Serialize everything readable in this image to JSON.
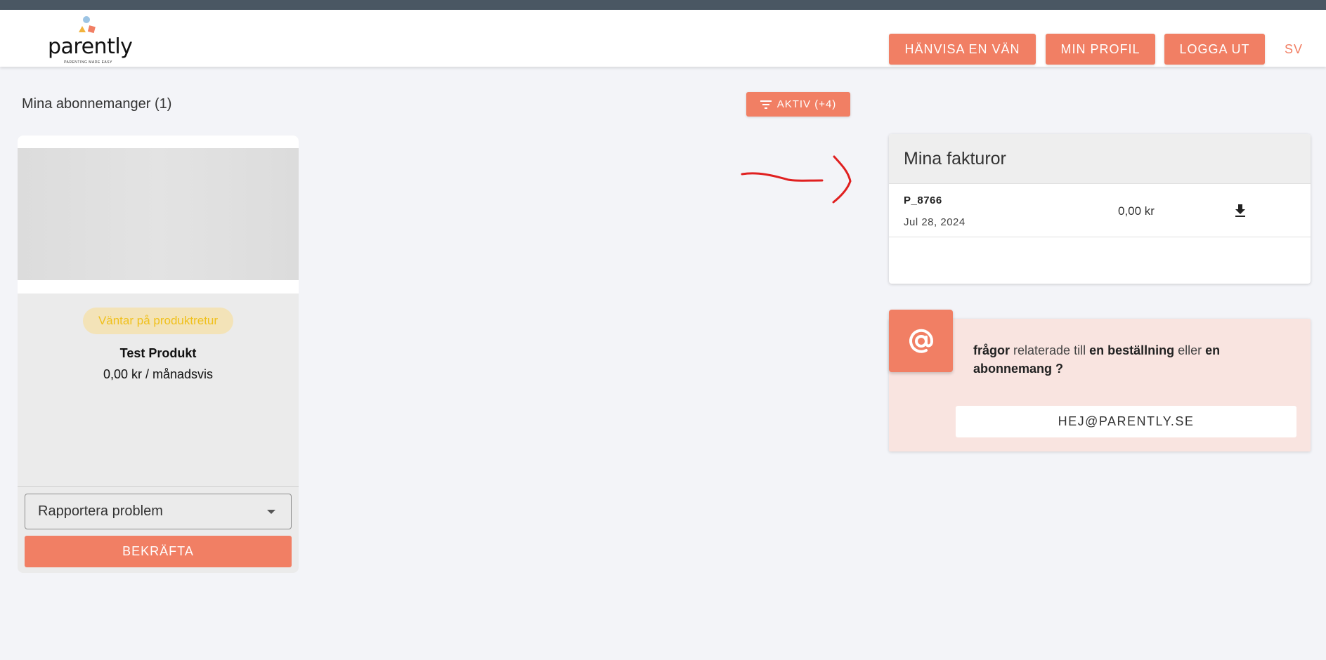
{
  "header": {
    "logo": {
      "wordmark": "parently",
      "tagline": "PARENTING MADE EASY"
    },
    "nav": [
      {
        "label": "HÄNVISA EN VÄN"
      },
      {
        "label": "MIN PROFIL"
      },
      {
        "label": "LOGGA UT"
      }
    ],
    "language": "SV"
  },
  "subscriptions": {
    "title": "Mina abonnemanger (1)",
    "filter_label": "AKTIV (+4)",
    "filter_icon": "filter-list-icon",
    "card": {
      "status": "Väntar på produktretur",
      "product_name": "Test Produkt",
      "price": "0,00 kr / månadsvis",
      "select_value": "Rapportera problem",
      "confirm_label": "BEKRÄFTA"
    }
  },
  "invoices": {
    "title": "Mina fakturor",
    "rows": [
      {
        "id": "P_8766",
        "date": "Jul 28, 2024",
        "amount": "0,00 kr",
        "icon": "download-icon"
      }
    ]
  },
  "contact": {
    "icon": "at-sign-icon",
    "text_parts": [
      "frågor",
      " relaterade till ",
      "en beställning",
      " eller ",
      "en abonnemang ?"
    ],
    "email_label": "HEJ@PARENTLY.SE"
  },
  "colors": {
    "accent": "#f17f64",
    "status_text": "#f0c01c",
    "status_bg": "#f3e3b8",
    "annotation": "#e02020"
  }
}
